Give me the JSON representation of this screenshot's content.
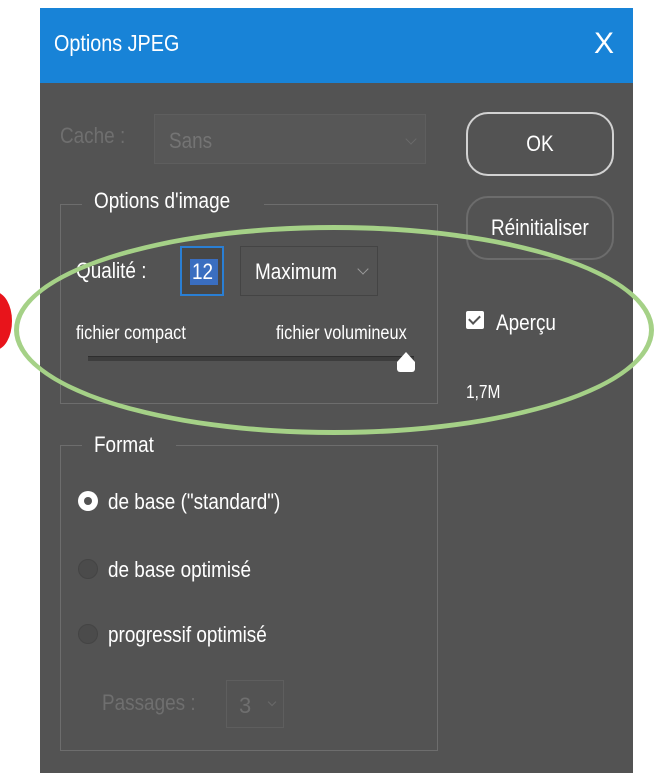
{
  "dialog": {
    "title": "Options JPEG",
    "close_glyph": "X"
  },
  "cache": {
    "label": "Cache :",
    "value": "Sans"
  },
  "buttons": {
    "ok": "OK",
    "reset": "Réinitialiser"
  },
  "image_options": {
    "legend": "Options d'image",
    "quality_label": "Qualité :",
    "quality_value": "12",
    "quality_preset": "Maximum",
    "slider_min_label": "fichier compact",
    "slider_max_label": "fichier volumineux",
    "slider_level": 1.0
  },
  "preview": {
    "label": "Aperçu",
    "checked": true,
    "file_size": "1,7M"
  },
  "format": {
    "legend": "Format",
    "options": [
      {
        "label": "de base  (\"standard\")",
        "selected": true
      },
      {
        "label": "de base optimisé",
        "selected": false
      },
      {
        "label": "progressif optimisé",
        "selected": false
      }
    ],
    "passes_label": "Passages :",
    "passes_value": "3"
  },
  "colors": {
    "titlebar": "#1883d7",
    "dialog_bg": "#535353",
    "highlight_ellipse": "#a5d187",
    "marker": "#e8141b"
  }
}
